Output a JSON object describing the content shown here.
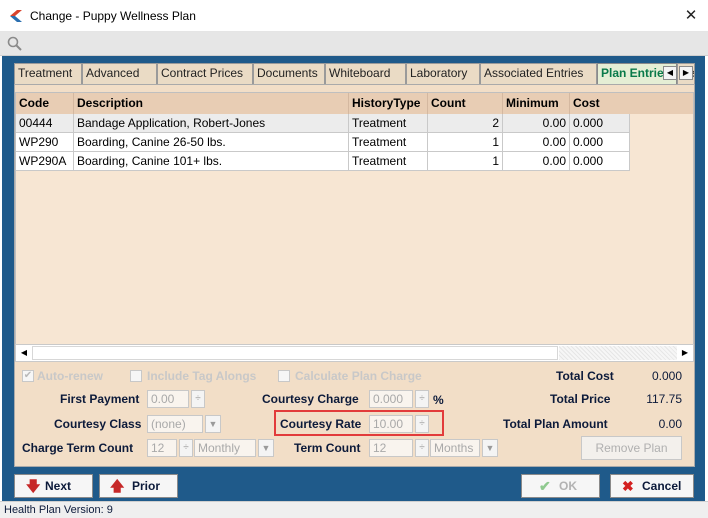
{
  "window": {
    "title": "Change - Puppy Wellness Plan"
  },
  "tabs": [
    {
      "label": "Treatment"
    },
    {
      "label": "Advanced"
    },
    {
      "label": "Contract Prices"
    },
    {
      "label": "Documents"
    },
    {
      "label": "Whiteboard"
    },
    {
      "label": "Laboratory"
    },
    {
      "label": "Associated Entries"
    },
    {
      "label": "Plan Entries",
      "active": true
    },
    {
      "label": "Re"
    }
  ],
  "grid": {
    "columns": [
      "Code",
      "Description",
      "HistoryType",
      "Count",
      "Minimum",
      "Cost"
    ],
    "rows": [
      {
        "code": "00444",
        "description": "Bandage Application, Robert-Jones",
        "history_type": "Treatment",
        "count": "2",
        "minimum": "0.00",
        "cost": "0.000"
      },
      {
        "code": "WP290",
        "description": "Boarding, Canine 26-50 lbs.",
        "history_type": "Treatment",
        "count": "1",
        "minimum": "0.00",
        "cost": "0.000"
      },
      {
        "code": "WP290A",
        "description": "Boarding, Canine 101+ lbs.",
        "history_type": "Treatment",
        "count": "1",
        "minimum": "0.00",
        "cost": "0.000"
      }
    ]
  },
  "options": {
    "auto_renew": {
      "label": "Auto-renew",
      "checked": true
    },
    "include_tag_alongs": {
      "label": "Include Tag Alongs",
      "checked": false
    },
    "calculate_plan_charge": {
      "label": "Calculate Plan Charge",
      "checked": false
    }
  },
  "fields": {
    "first_payment": {
      "label": "First Payment",
      "value": "0.00"
    },
    "courtesy_charge": {
      "label": "Courtesy Charge",
      "value": "0.000",
      "unit": "%"
    },
    "courtesy_class": {
      "label": "Courtesy Class",
      "value": "(none)"
    },
    "courtesy_rate": {
      "label": "Courtesy Rate",
      "value": "10.00"
    },
    "charge_term_count": {
      "label": "Charge Term Count",
      "value": "12",
      "period": "Monthly"
    },
    "term_count": {
      "label": "Term Count",
      "value": "12",
      "period": "Months"
    }
  },
  "totals": {
    "total_cost": {
      "label": "Total Cost",
      "value": "0.000"
    },
    "total_price": {
      "label": "Total Price",
      "value": "117.75"
    },
    "total_plan_amount": {
      "label": "Total Plan Amount",
      "value": "0.00"
    }
  },
  "buttons": {
    "remove_plan": "Remove Plan",
    "next": "Next",
    "prior": "Prior",
    "ok": "OK",
    "cancel": "Cancel"
  },
  "status": {
    "text": "Health Plan Version: 9"
  },
  "colors": {
    "frame": "#1f5a8a",
    "panel": "#f2dec7",
    "active_tab": "#0a7a4a",
    "highlight": "#e23b3b",
    "cancel_icon": "#d32020",
    "arrow_icon": "#c62828",
    "ok_icon": "#8fc98f"
  }
}
